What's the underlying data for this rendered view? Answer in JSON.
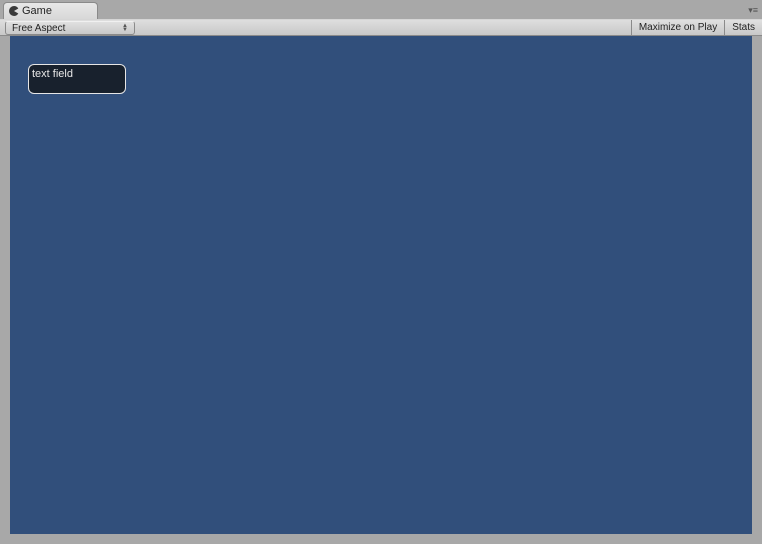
{
  "tab": {
    "label": "Game"
  },
  "toolbar": {
    "aspect_label": "Free Aspect",
    "maximize_label": "Maximize on Play",
    "stats_label": "Stats"
  },
  "viewport": {
    "text_field_value": "text field"
  }
}
